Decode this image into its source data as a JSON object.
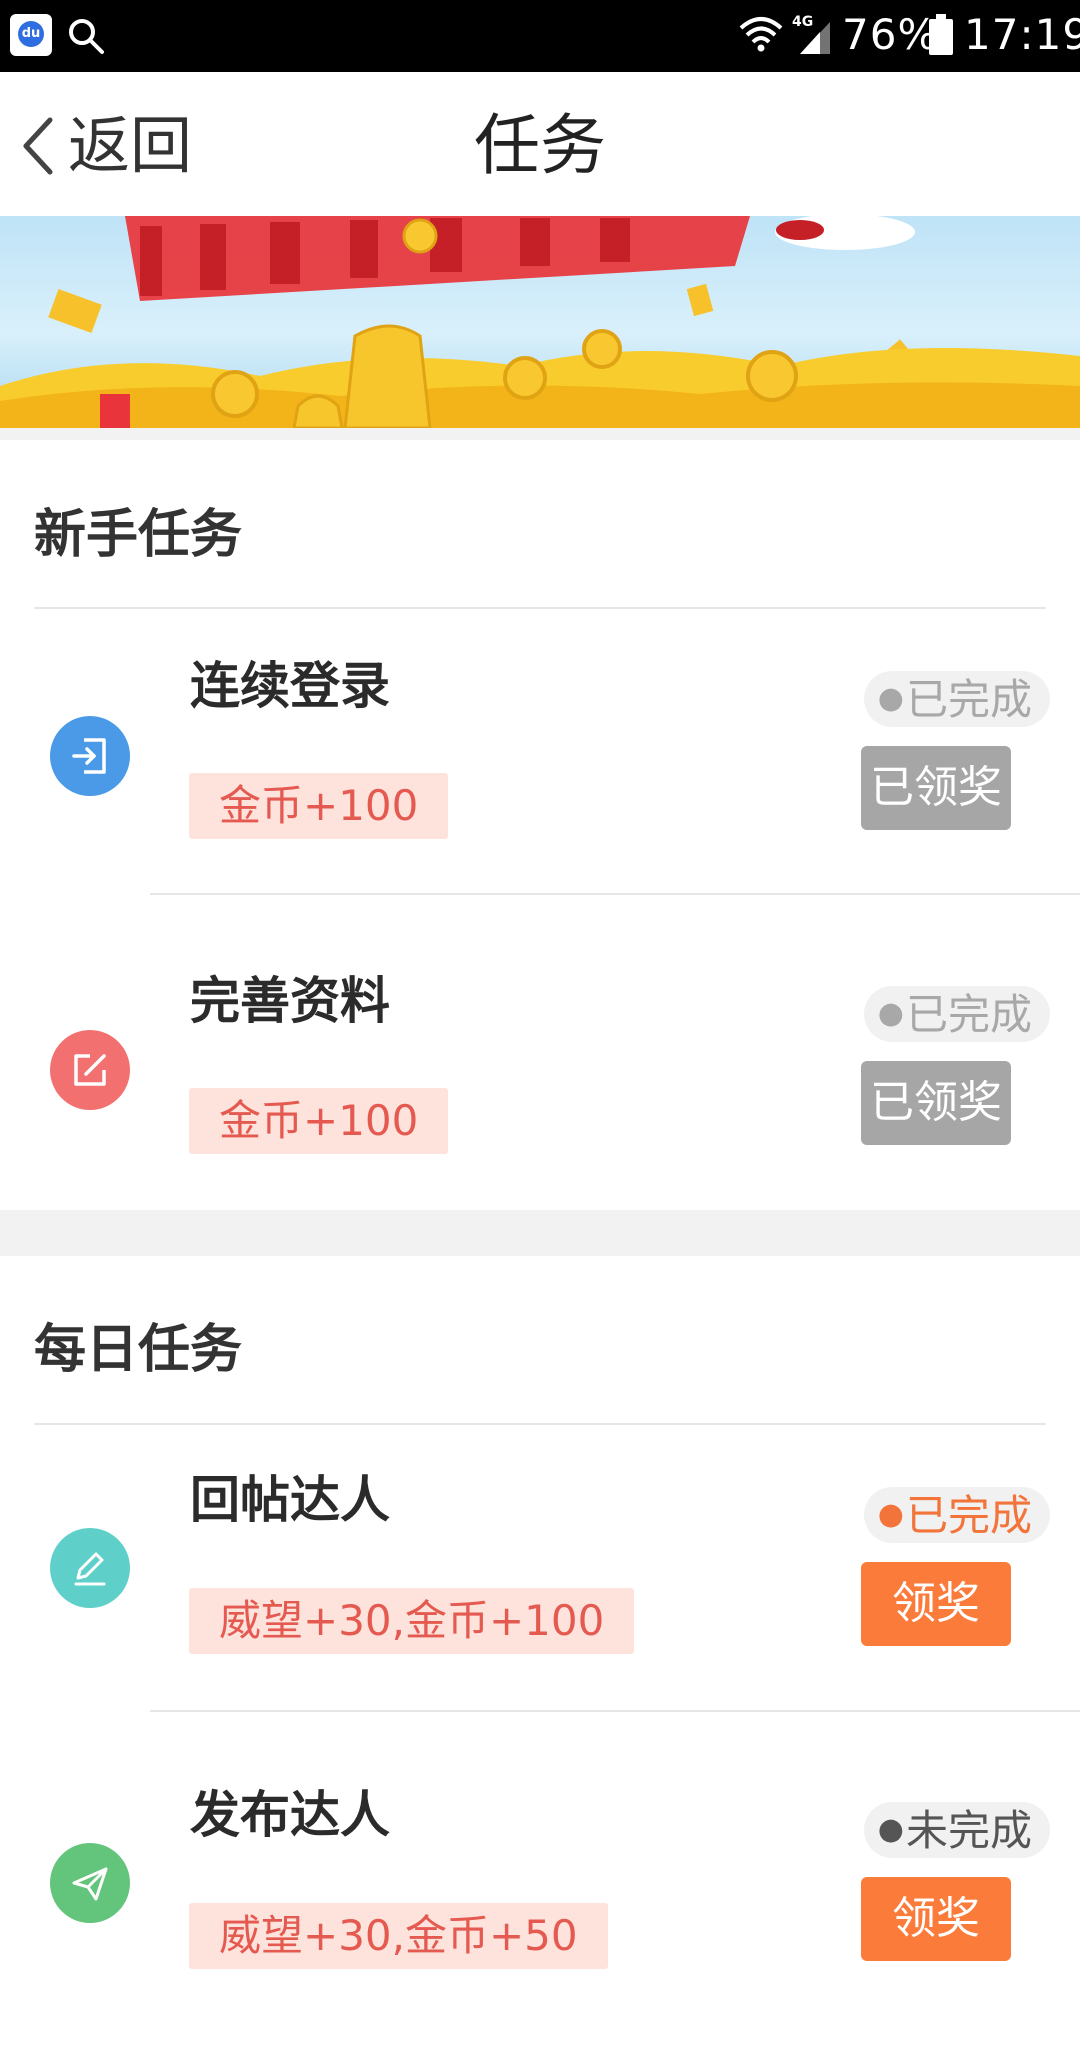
{
  "status_bar": {
    "battery_percent": "76%",
    "time": "17:19",
    "network": "4G",
    "icons": [
      "baidu-app-icon",
      "search-icon",
      "wifi-icon",
      "signal-icon",
      "battery-icon"
    ]
  },
  "nav": {
    "back_label": "返回",
    "title": "任务"
  },
  "sections": [
    {
      "title": "新手任务",
      "tasks": [
        {
          "name": "连续登录",
          "reward": "金币+100",
          "status": "已完成",
          "action": "已领奖",
          "icon": "login-icon",
          "icon_color": "#4a9ae8"
        },
        {
          "name": "完善资料",
          "reward": "金币+100",
          "status": "已完成",
          "action": "已领奖",
          "icon": "edit-icon",
          "icon_color": "#f2706f"
        }
      ]
    },
    {
      "title": "每日任务",
      "tasks": [
        {
          "name": "回帖达人",
          "reward": "威望+30,金币+100",
          "status": "已完成",
          "action": "领奖",
          "icon": "pen-icon",
          "icon_color": "#5fcfc9"
        },
        {
          "name": "发布达人",
          "reward": "威望+30,金币+50",
          "status": "未完成",
          "action": "领奖",
          "icon": "send-icon",
          "icon_color": "#63c47c"
        }
      ]
    }
  ],
  "colors": {
    "accent_orange": "#fb7b3b",
    "reward_bg": "#fde3dc",
    "reward_text": "#e55a50",
    "claimed_gray": "#a6a6a6"
  }
}
